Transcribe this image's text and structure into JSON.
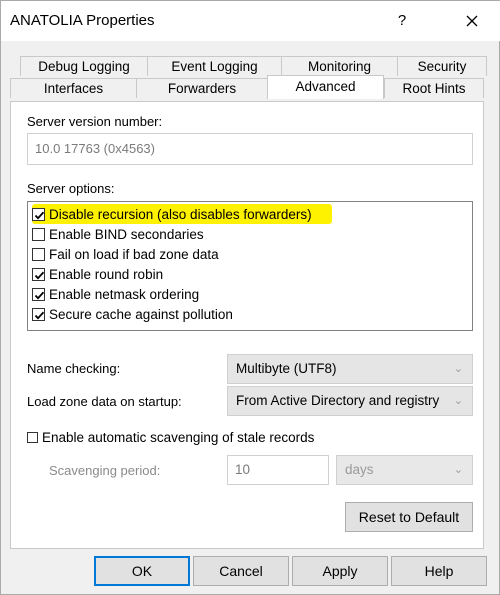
{
  "window": {
    "title": "ANATOLIA Properties",
    "help_label": "?"
  },
  "tabs": {
    "row1": [
      {
        "label": "Debug Logging"
      },
      {
        "label": "Event Logging"
      },
      {
        "label": "Monitoring"
      },
      {
        "label": "Security"
      }
    ],
    "row2": [
      {
        "label": "Interfaces"
      },
      {
        "label": "Forwarders"
      },
      {
        "label": "Advanced",
        "active": true
      },
      {
        "label": "Root Hints"
      }
    ]
  },
  "advanced": {
    "version_label": "Server version number:",
    "version_value": "10.0 17763 (0x4563)",
    "options_label": "Server options:",
    "options": [
      {
        "label": "Disable recursion (also disables forwarders)",
        "checked": true,
        "highlighted": true
      },
      {
        "label": "Enable BIND secondaries",
        "checked": false
      },
      {
        "label": "Fail on load if bad zone data",
        "checked": false
      },
      {
        "label": "Enable round robin",
        "checked": true
      },
      {
        "label": "Enable netmask ordering",
        "checked": true
      },
      {
        "label": "Secure cache against pollution",
        "checked": true
      }
    ],
    "name_checking_label": "Name checking:",
    "name_checking_value": "Multibyte (UTF8)",
    "load_zone_label": "Load zone data on startup:",
    "load_zone_value": "From Active Directory and registry",
    "scavenging_label": "Enable automatic scavenging of stale records",
    "scavenging_checked": false,
    "period_label": "Scavenging period:",
    "period_value": "10",
    "period_unit": "days",
    "reset_label": "Reset to Default"
  },
  "footer": {
    "ok": "OK",
    "cancel": "Cancel",
    "apply": "Apply",
    "help": "Help"
  },
  "colors": {
    "highlight": "#fff200",
    "default_button_border": "#0078d7"
  }
}
